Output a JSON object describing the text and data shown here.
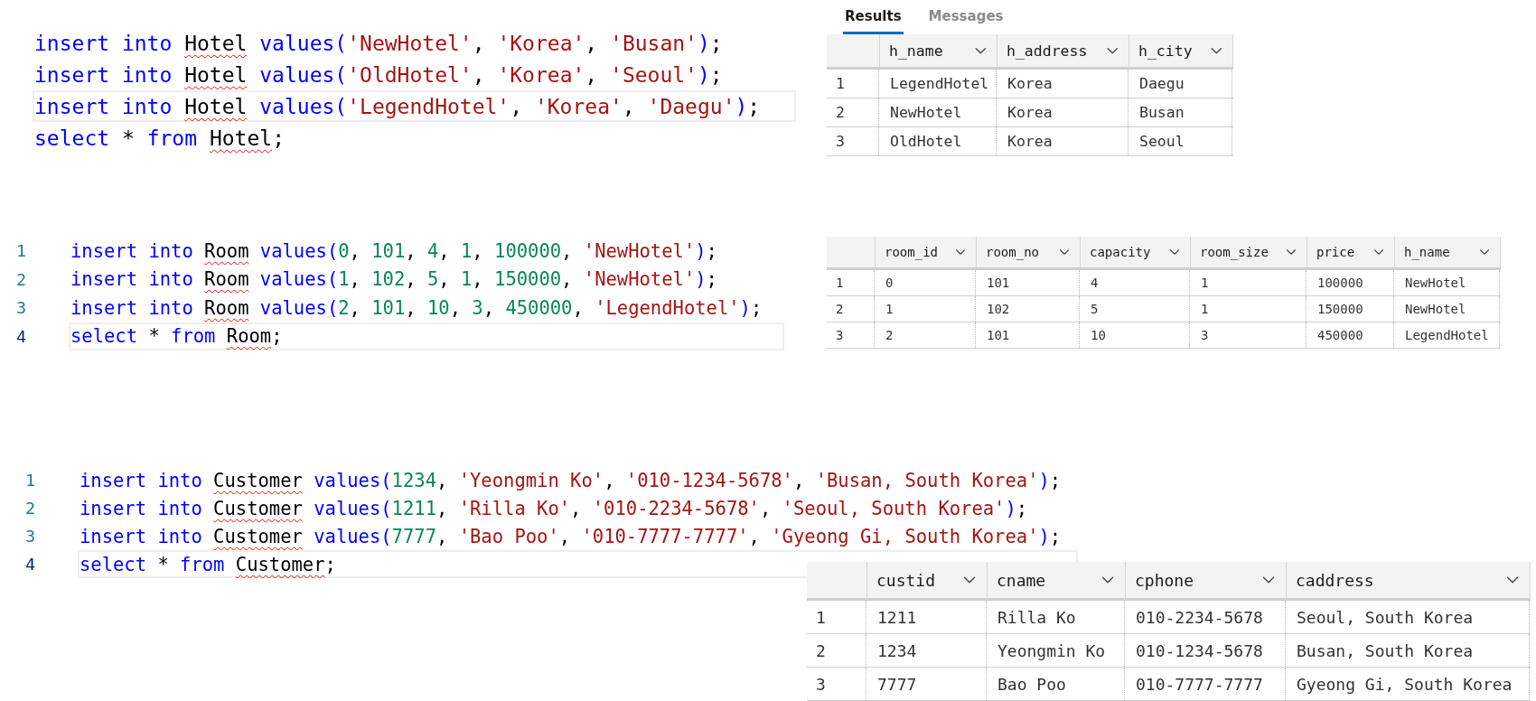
{
  "sections": [
    {
      "editor": {
        "lines": [
          {
            "current": false,
            "tokens": [
              {
                "kind": "keyword",
                "text": "insert into "
              },
              {
                "kind": "ident",
                "text": "Hotel"
              },
              {
                "kind": "keyword",
                "text": " values("
              },
              {
                "kind": "string",
                "text": "'NewHotel'"
              },
              {
                "kind": "plain",
                "text": ", "
              },
              {
                "kind": "string",
                "text": "'Korea'"
              },
              {
                "kind": "plain",
                "text": ", "
              },
              {
                "kind": "string",
                "text": "'Busan'"
              },
              {
                "kind": "keyword",
                "text": ")"
              },
              {
                "kind": "plain",
                "text": ";"
              }
            ]
          },
          {
            "current": false,
            "tokens": [
              {
                "kind": "keyword",
                "text": "insert into "
              },
              {
                "kind": "ident",
                "text": "Hotel"
              },
              {
                "kind": "keyword",
                "text": " values("
              },
              {
                "kind": "string",
                "text": "'OldHotel'"
              },
              {
                "kind": "plain",
                "text": ", "
              },
              {
                "kind": "string",
                "text": "'Korea'"
              },
              {
                "kind": "plain",
                "text": ", "
              },
              {
                "kind": "string",
                "text": "'Seoul'"
              },
              {
                "kind": "keyword",
                "text": ")"
              },
              {
                "kind": "plain",
                "text": ";"
              }
            ]
          },
          {
            "current": true,
            "tokens": [
              {
                "kind": "keyword",
                "text": "insert into "
              },
              {
                "kind": "ident",
                "text": "Hotel"
              },
              {
                "kind": "keyword",
                "text": " values("
              },
              {
                "kind": "string",
                "text": "'LegendHotel'"
              },
              {
                "kind": "plain",
                "text": ", "
              },
              {
                "kind": "string",
                "text": "'Korea'"
              },
              {
                "kind": "plain",
                "text": ", "
              },
              {
                "kind": "string",
                "text": "'Daegu'"
              },
              {
                "kind": "keyword",
                "text": ")"
              },
              {
                "kind": "plain",
                "text": ";"
              }
            ]
          },
          {
            "current": false,
            "tokens": [
              {
                "kind": "keyword",
                "text": "select"
              },
              {
                "kind": "plain",
                "text": " * "
              },
              {
                "kind": "keyword",
                "text": "from "
              },
              {
                "kind": "ident",
                "text": "Hotel"
              },
              {
                "kind": "plain",
                "text": ";"
              }
            ]
          }
        ]
      },
      "grid": {
        "tabs": [
          {
            "label": "Results",
            "selected": true
          },
          {
            "label": "Messages",
            "selected": false
          }
        ],
        "columns": [
          "h_name",
          "h_address",
          "h_city"
        ],
        "rows": [
          {
            "number": "1",
            "cells": [
              "LegendHotel",
              "Korea",
              "Daegu"
            ]
          },
          {
            "number": "2",
            "cells": [
              "NewHotel",
              "Korea",
              "Busan"
            ]
          },
          {
            "number": "3",
            "cells": [
              "OldHotel",
              "Korea",
              "Seoul"
            ]
          }
        ]
      }
    },
    {
      "editor": {
        "lines": [
          {
            "number": "1",
            "current": false,
            "tokens": [
              {
                "kind": "keyword",
                "text": "insert into "
              },
              {
                "kind": "ident",
                "text": "Room"
              },
              {
                "kind": "keyword",
                "text": " values("
              },
              {
                "kind": "number",
                "text": "0"
              },
              {
                "kind": "plain",
                "text": ", "
              },
              {
                "kind": "number",
                "text": "101"
              },
              {
                "kind": "plain",
                "text": ", "
              },
              {
                "kind": "number",
                "text": "4"
              },
              {
                "kind": "plain",
                "text": ", "
              },
              {
                "kind": "number",
                "text": "1"
              },
              {
                "kind": "plain",
                "text": ", "
              },
              {
                "kind": "number",
                "text": "100000"
              },
              {
                "kind": "plain",
                "text": ", "
              },
              {
                "kind": "string",
                "text": "'NewHotel'"
              },
              {
                "kind": "keyword",
                "text": ")"
              },
              {
                "kind": "plain",
                "text": ";"
              }
            ]
          },
          {
            "number": "2",
            "current": false,
            "tokens": [
              {
                "kind": "keyword",
                "text": "insert into "
              },
              {
                "kind": "ident",
                "text": "Room"
              },
              {
                "kind": "keyword",
                "text": " values("
              },
              {
                "kind": "number",
                "text": "1"
              },
              {
                "kind": "plain",
                "text": ", "
              },
              {
                "kind": "number",
                "text": "102"
              },
              {
                "kind": "plain",
                "text": ", "
              },
              {
                "kind": "number",
                "text": "5"
              },
              {
                "kind": "plain",
                "text": ", "
              },
              {
                "kind": "number",
                "text": "1"
              },
              {
                "kind": "plain",
                "text": ", "
              },
              {
                "kind": "number",
                "text": "150000"
              },
              {
                "kind": "plain",
                "text": ", "
              },
              {
                "kind": "string",
                "text": "'NewHotel'"
              },
              {
                "kind": "keyword",
                "text": ")"
              },
              {
                "kind": "plain",
                "text": ";"
              }
            ]
          },
          {
            "number": "3",
            "current": false,
            "tokens": [
              {
                "kind": "keyword",
                "text": "insert into "
              },
              {
                "kind": "ident",
                "text": "Room"
              },
              {
                "kind": "keyword",
                "text": " values("
              },
              {
                "kind": "number",
                "text": "2"
              },
              {
                "kind": "plain",
                "text": ", "
              },
              {
                "kind": "number",
                "text": "101"
              },
              {
                "kind": "plain",
                "text": ", "
              },
              {
                "kind": "number",
                "text": "10"
              },
              {
                "kind": "plain",
                "text": ", "
              },
              {
                "kind": "number",
                "text": "3"
              },
              {
                "kind": "plain",
                "text": ", "
              },
              {
                "kind": "number",
                "text": "450000"
              },
              {
                "kind": "plain",
                "text": ", "
              },
              {
                "kind": "string",
                "text": "'LegendHotel'"
              },
              {
                "kind": "keyword",
                "text": ")"
              },
              {
                "kind": "plain",
                "text": ";"
              }
            ]
          },
          {
            "number": "4",
            "current": true,
            "tokens": [
              {
                "kind": "keyword",
                "text": "select"
              },
              {
                "kind": "plain",
                "text": " * "
              },
              {
                "kind": "keyword",
                "text": "from "
              },
              {
                "kind": "ident",
                "text": "Room"
              },
              {
                "kind": "plain",
                "text": ";"
              }
            ]
          }
        ]
      },
      "grid": {
        "columns": [
          "room_id",
          "room_no",
          "capacity",
          "room_size",
          "price",
          "h_name"
        ],
        "rows": [
          {
            "number": "1",
            "cells": [
              "0",
              "101",
              "4",
              "1",
              "100000",
              "NewHotel"
            ]
          },
          {
            "number": "2",
            "cells": [
              "1",
              "102",
              "5",
              "1",
              "150000",
              "NewHotel"
            ]
          },
          {
            "number": "3",
            "cells": [
              "2",
              "101",
              "10",
              "3",
              "450000",
              "LegendHotel"
            ]
          }
        ]
      }
    },
    {
      "editor": {
        "lines": [
          {
            "number": "1",
            "current": false,
            "tokens": [
              {
                "kind": "keyword",
                "text": "insert into "
              },
              {
                "kind": "ident",
                "text": "Customer"
              },
              {
                "kind": "keyword",
                "text": " values("
              },
              {
                "kind": "number",
                "text": "1234"
              },
              {
                "kind": "plain",
                "text": ", "
              },
              {
                "kind": "string",
                "text": "'Yeongmin Ko'"
              },
              {
                "kind": "plain",
                "text": ", "
              },
              {
                "kind": "string",
                "text": "'010-1234-5678'"
              },
              {
                "kind": "plain",
                "text": ", "
              },
              {
                "kind": "string",
                "text": "'Busan, South Korea'"
              },
              {
                "kind": "keyword",
                "text": ")"
              },
              {
                "kind": "plain",
                "text": ";"
              }
            ]
          },
          {
            "number": "2",
            "current": false,
            "tokens": [
              {
                "kind": "keyword",
                "text": "insert into "
              },
              {
                "kind": "ident",
                "text": "Customer"
              },
              {
                "kind": "keyword",
                "text": " values("
              },
              {
                "kind": "number",
                "text": "1211"
              },
              {
                "kind": "plain",
                "text": ", "
              },
              {
                "kind": "string",
                "text": "'Rilla Ko'"
              },
              {
                "kind": "plain",
                "text": ", "
              },
              {
                "kind": "string",
                "text": "'010-2234-5678'"
              },
              {
                "kind": "plain",
                "text": ", "
              },
              {
                "kind": "string",
                "text": "'Seoul, South Korea'"
              },
              {
                "kind": "keyword",
                "text": ")"
              },
              {
                "kind": "plain",
                "text": ";"
              }
            ]
          },
          {
            "number": "3",
            "current": false,
            "tokens": [
              {
                "kind": "keyword",
                "text": "insert into "
              },
              {
                "kind": "ident",
                "text": "Customer"
              },
              {
                "kind": "keyword",
                "text": " values("
              },
              {
                "kind": "number",
                "text": "7777"
              },
              {
                "kind": "plain",
                "text": ", "
              },
              {
                "kind": "string",
                "text": "'Bao Poo'"
              },
              {
                "kind": "plain",
                "text": ", "
              },
              {
                "kind": "string",
                "text": "'010-7777-7777'"
              },
              {
                "kind": "plain",
                "text": ", "
              },
              {
                "kind": "string",
                "text": "'Gyeong Gi, South Korea'"
              },
              {
                "kind": "keyword",
                "text": ")"
              },
              {
                "kind": "plain",
                "text": ";"
              }
            ]
          },
          {
            "number": "4",
            "current": true,
            "tokens": [
              {
                "kind": "keyword",
                "text": "select"
              },
              {
                "kind": "plain",
                "text": " * "
              },
              {
                "kind": "keyword",
                "text": "from "
              },
              {
                "kind": "ident",
                "text": "Customer"
              },
              {
                "kind": "plain",
                "text": ";"
              }
            ]
          }
        ]
      },
      "grid": {
        "columns": [
          "custid",
          "cname",
          "cphone",
          "caddress"
        ],
        "rows": [
          {
            "number": "1",
            "cells": [
              "1211",
              "Rilla Ko",
              "010-2234-5678",
              "Seoul, South Korea"
            ]
          },
          {
            "number": "2",
            "cells": [
              "1234",
              "Yeongmin Ko",
              "010-1234-5678",
              "Busan, South Korea"
            ]
          },
          {
            "number": "3",
            "cells": [
              "7777",
              "Bao Poo",
              "010-7777-7777",
              "Gyeong Gi, South Korea"
            ]
          }
        ]
      }
    }
  ]
}
